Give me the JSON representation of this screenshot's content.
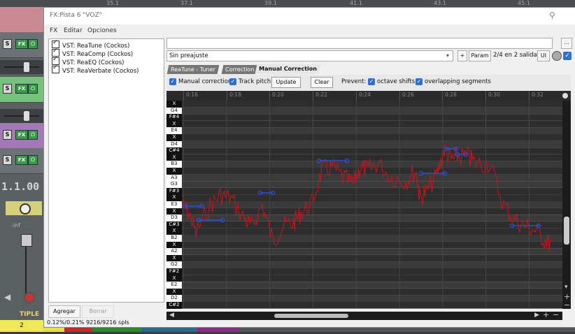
{
  "daw": {
    "ruler_labels": [
      "35.1",
      "37.1",
      "39.1",
      "41.1",
      "43.1",
      "45.1"
    ],
    "track_buttons": {
      "solo": "S",
      "fx": "FX",
      "power": "⏻"
    },
    "timecode": "1.1.00",
    "volume_label": "-inf",
    "track_name": "TIPLE",
    "track_number": "2"
  },
  "fx_window": {
    "title": "FX:Pista 6 \"VOZ\"",
    "menu": [
      "FX",
      "Editar",
      "Opciones"
    ],
    "plugins": [
      "VST: ReaTune (Cockos)",
      "VST: ReaComp (Cockos)",
      "VST: ReaEQ (Cockos)",
      "VST: ReaVerbate (Cockos)"
    ],
    "add_label": "Agregar",
    "remove_label": "Borrar",
    "cpu_text": "0.12%/0.21% 9216/9216 spls"
  },
  "plugin_header": {
    "dots_label": "...",
    "preset": "Sin preajuste",
    "plus_label": "+",
    "param_label": "Param",
    "io_label": "2/4 en 2 salida",
    "ui_label": "UI"
  },
  "tabs": [
    {
      "label": "ReaTune - Tuner",
      "active": false
    },
    {
      "label": "Correction",
      "active": false
    },
    {
      "label": "Manual Correction",
      "active": true
    }
  ],
  "options": {
    "manual_correction": "Manual correction",
    "track_pitch": "Track pitch",
    "update": "Update",
    "clear": "Clear",
    "prevent": "Prevent:",
    "octave_shifts": "octave shifts",
    "overlapping_segments": "overlapping segments"
  },
  "timeline_labels": [
    "0:16",
    "0:18",
    "0:20",
    "0:22",
    "0:24",
    "0:26",
    "0:28",
    "0:30",
    "0:32"
  ],
  "piano_keys": [
    "X",
    "G4",
    "F#4",
    "X",
    "E4",
    "X",
    "D4",
    "C#4",
    "X",
    "B3",
    "X",
    "A3",
    "G3",
    "F#3",
    "X",
    "E3",
    "X",
    "D3",
    "C#3",
    "X",
    "B2",
    "X",
    "A2",
    "X",
    "G2",
    "F#2",
    "X",
    "E2",
    "X",
    "D2",
    "C#2"
  ],
  "colors": {
    "pitch_line": "#c8141e",
    "correction": "#2a4fd6",
    "accent": "#2f6fcf"
  }
}
